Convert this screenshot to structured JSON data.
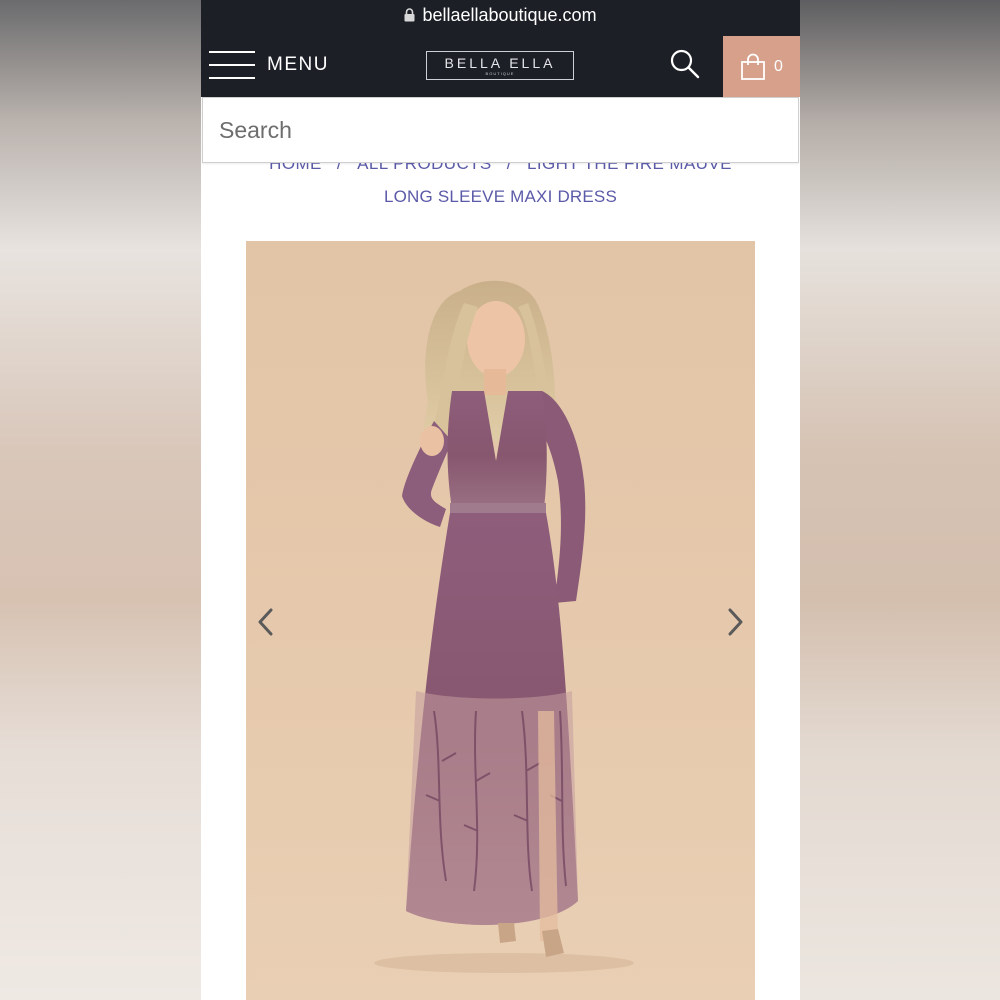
{
  "browser": {
    "url": "bellaellaboutique.com",
    "lock_icon": "lock-icon"
  },
  "header": {
    "menu_label": "MENU",
    "menu_icon": "hamburger-icon",
    "logo_text": "BELLA ELLA",
    "logo_subtext": "BOUTIQUE",
    "search_icon": "search-icon",
    "cart_icon": "shopping-bag-icon",
    "cart_count": "0",
    "cart_color": "#d7a08b",
    "nav_color": "#1c1f26"
  },
  "search": {
    "placeholder": "Search",
    "value": ""
  },
  "breadcrumb": {
    "items": [
      "HOME",
      "ALL PRODUCTS",
      "LIGHT THE FIRE MAUVE"
    ],
    "separator": "/",
    "current": "LONG SLEEVE MAXI DRESS",
    "color": "#5b5aa8"
  },
  "gallery": {
    "image_alt": "Model wearing mauve lace long sleeve maxi dress",
    "prev_icon": "chevron-left-icon",
    "next_icon": "chevron-right-icon",
    "background_color": "#e4c7a9",
    "dress_color": "#8a5b79"
  }
}
